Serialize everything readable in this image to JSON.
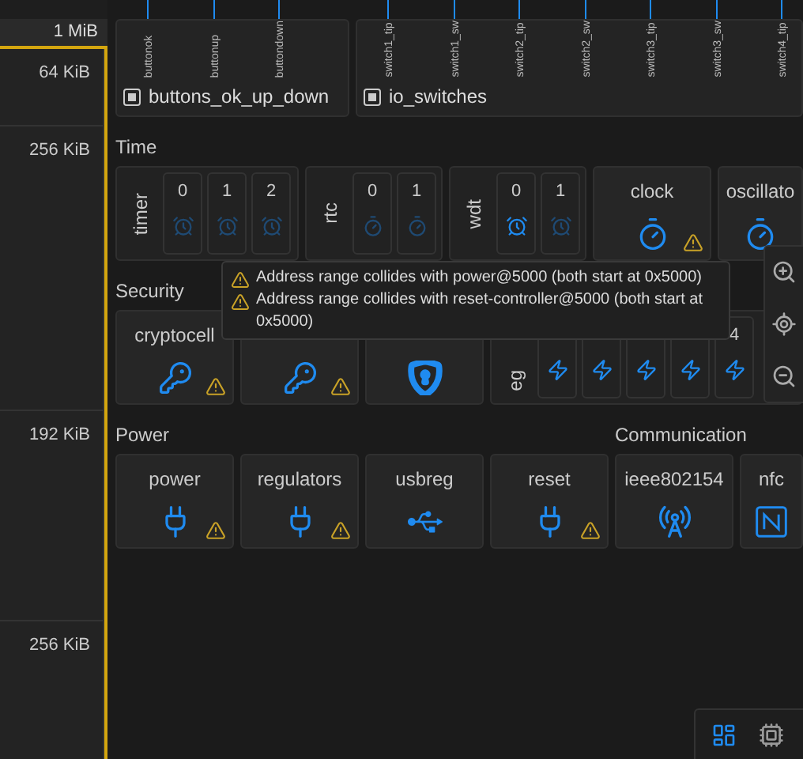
{
  "memory_map": {
    "header": "1 MiB",
    "highlighted": true,
    "regions": [
      {
        "size": "64 KiB"
      },
      {
        "size": "256 KiB"
      },
      {
        "size": "192 KiB"
      },
      {
        "size": "256 KiB"
      }
    ]
  },
  "pin_devices": [
    {
      "name": "buttons_ok_up_down",
      "pins": [
        "buttonok",
        "buttonup",
        "buttondown"
      ]
    },
    {
      "name": "io_switches",
      "pins": [
        "switch1_tip",
        "switch1_sw",
        "switch2_tip",
        "switch2_sw",
        "switch3_tip",
        "switch3_sw",
        "switch4_tip"
      ]
    }
  ],
  "rows": [
    {
      "sections": [
        {
          "title": "Time",
          "items": [
            {
              "kind": "group",
              "label": "timer",
              "cells": [
                {
                  "label": "0",
                  "enabled": false
                },
                {
                  "label": "1",
                  "enabled": false
                },
                {
                  "label": "2",
                  "enabled": false
                }
              ]
            },
            {
              "kind": "group",
              "label": "rtc",
              "cells": [
                {
                  "label": "0",
                  "enabled": false
                },
                {
                  "label": "1",
                  "enabled": false
                }
              ]
            },
            {
              "kind": "group",
              "label": "wdt",
              "cells": [
                {
                  "label": "0",
                  "enabled": true
                },
                {
                  "label": "1",
                  "enabled": false
                }
              ]
            },
            {
              "kind": "card",
              "name": "clock",
              "warning": true
            },
            {
              "kind": "card",
              "name": "oscillato",
              "warning": false
            }
          ]
        }
      ]
    },
    {
      "sections": [
        {
          "title": "Security",
          "items": [
            {
              "kind": "card",
              "name": "cryptocell",
              "warning": true
            },
            {
              "kind": "card",
              "warning": true
            },
            {
              "kind": "card",
              "warning": false
            },
            {
              "kind": "group",
              "label": "eg",
              "cells": [
                {
                  "enabled": true
                },
                {
                  "enabled": true
                },
                {
                  "enabled": true
                },
                {
                  "enabled": true
                },
                {
                  "label": "4",
                  "enabled": true
                }
              ]
            }
          ]
        }
      ]
    },
    {
      "sections": [
        {
          "title": "Power",
          "items": [
            {
              "kind": "card",
              "name": "power",
              "warning": true
            },
            {
              "kind": "card",
              "name": "regulators",
              "warning": true
            },
            {
              "kind": "card",
              "name": "usbreg",
              "warning": false
            },
            {
              "kind": "card",
              "name": "reset",
              "warning": true
            }
          ]
        },
        {
          "title": "Communication",
          "items": [
            {
              "kind": "card",
              "name": "ieee802154",
              "warning": false
            },
            {
              "kind": "card",
              "name": "nfc",
              "warning": false
            }
          ]
        }
      ]
    }
  ],
  "tooltip": {
    "messages": [
      "Address range collides with power@5000 (both start at 0x5000)",
      "Address range collides with reset-controller@5000 (both start at 0x5000)"
    ]
  },
  "toolbar": [
    {
      "selected": true
    },
    {
      "selected": false
    }
  ]
}
